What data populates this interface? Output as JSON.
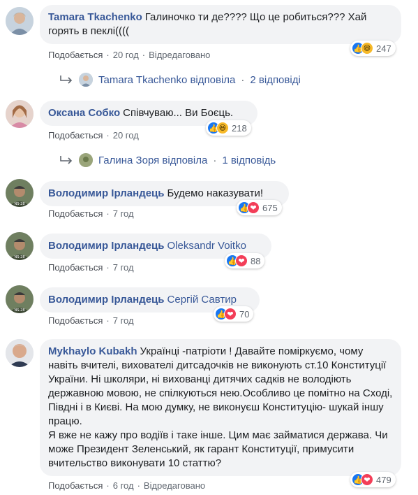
{
  "colors": {
    "link": "#385898",
    "bubble": "#f2f3f5",
    "like": "#1877f2",
    "love": "#f33e58",
    "haha": "#f7b928"
  },
  "comments": [
    {
      "author": "Tamara Tkachenko",
      "text": "Галиночко ти де???? Що це робиться??? Хай горять в пеклі((((",
      "like_label": "Подобається",
      "time": "20 год",
      "edited": "Відредаговано",
      "reactions": [
        "like",
        "haha"
      ],
      "count": "247",
      "reply": {
        "name": "Tamara Tkachenko відповіла",
        "count": "2 відповіді"
      }
    },
    {
      "author": "Оксана Собко",
      "text": "Співчуваю... Ви Боєць.",
      "like_label": "Подобається",
      "time": "20 год",
      "reactions": [
        "like",
        "haha"
      ],
      "count": "218",
      "reply": {
        "name": "Галина Зоря відповіла",
        "count": "1 відповідь"
      }
    },
    {
      "author": "Володимир Ірландець",
      "text": "Будемо наказувати!",
      "like_label": "Подобається",
      "time": "7 год",
      "reactions": [
        "like",
        "love"
      ],
      "count": "675"
    },
    {
      "author": "Володимир Ірландець",
      "tag": "Oleksandr Voitko",
      "like_label": "Подобається",
      "time": "7 год",
      "reactions": [
        "like",
        "love"
      ],
      "count": "88"
    },
    {
      "author": "Володимир Ірландець",
      "tag": "Сергій Савтир",
      "like_label": "Подобається",
      "time": "7 год",
      "reactions": [
        "like",
        "love"
      ],
      "count": "70"
    },
    {
      "author": "Mykhaylo Kubakh",
      "text": "Українці -патріоти ! Давайте поміркуємо, чому навіть вчителі, вихователі дитсадочків не виконують ст.10 Конституції України. Ні школяри, ні вихованці дитячих садків не володіють державною мовою, не спілкуються нею.Особливо це помітно на Сході, Півдні і в Києві. На мою думку, не виконуєш Конституцію- шукай іншу працю.",
      "text2": "Я вже не кажу про водіїв і таке інше. Цим має займатися держава. Чи може Президент Зеленський, як гарант Конституції, примусити вчительство виконувати 10 статтю?",
      "like_label": "Подобається",
      "time": "6 год",
      "edited": "Відредаговано",
      "reactions": [
        "like",
        "love"
      ],
      "count": "479"
    }
  ]
}
